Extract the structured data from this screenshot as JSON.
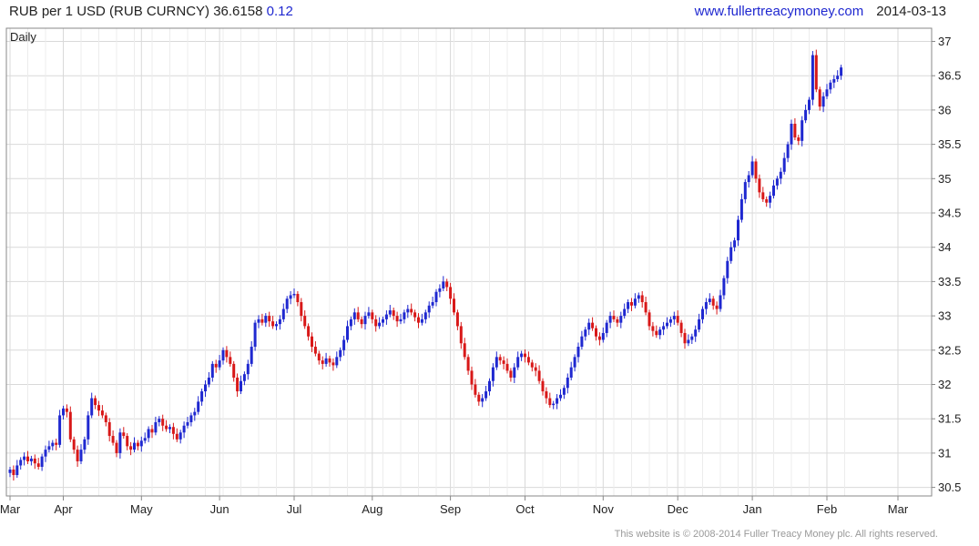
{
  "header": {
    "title": "RUB per 1 USD (RUB CURNCY)",
    "last": "36.6158",
    "change": "0.12",
    "website": "www.fullertreacymoney.com",
    "date": "2014-03-13"
  },
  "footer": {
    "copyright": "This website is © 2008-2014 Fuller Treacy Money plc. All rights reserved."
  },
  "colors": {
    "up": "#1f28d0",
    "down": "#d81818",
    "grid": "#d9d9d9",
    "frame": "#888888",
    "period_label": "#1f28d0"
  },
  "chart_data": {
    "type": "candlestick",
    "title": "RUB per 1 USD (RUB CURNCY)",
    "period_label": "Daily",
    "y_axis": {
      "position": "right",
      "ylim": [
        30.4,
        37.2
      ],
      "ticks": [
        30.5,
        31,
        31.5,
        32,
        32.5,
        33,
        33.5,
        34,
        34.5,
        35,
        35.5,
        36,
        36.5,
        37
      ]
    },
    "x_axis": {
      "months": [
        "Mar",
        "Apr",
        "May",
        "Jun",
        "Jul",
        "Aug",
        "Sep",
        "Oct",
        "Nov",
        "Dec",
        "Jan",
        "Feb",
        "Mar"
      ],
      "month_start_index": [
        0,
        15,
        37,
        59,
        80,
        102,
        124,
        145,
        167,
        188,
        209,
        230,
        250
      ]
    },
    "grid": true,
    "legend": "none",
    "closes": [
      30.76,
      30.68,
      30.82,
      30.9,
      30.95,
      30.88,
      30.92,
      30.85,
      30.8,
      30.95,
      31.05,
      31.1,
      31.15,
      31.12,
      31.55,
      31.65,
      31.6,
      31.2,
      31.05,
      30.88,
      31.05,
      31.2,
      31.55,
      31.8,
      31.7,
      31.62,
      31.55,
      31.45,
      31.25,
      31.15,
      31.0,
      31.3,
      31.25,
      31.1,
      31.05,
      31.15,
      31.1,
      31.18,
      31.22,
      31.35,
      31.3,
      31.45,
      31.5,
      31.4,
      31.35,
      31.38,
      31.28,
      31.2,
      31.3,
      31.4,
      31.45,
      31.55,
      31.6,
      31.75,
      31.9,
      32.0,
      32.1,
      32.3,
      32.25,
      32.35,
      32.5,
      32.4,
      32.3,
      32.1,
      31.9,
      32.05,
      32.15,
      32.3,
      32.55,
      32.9,
      32.95,
      32.9,
      33.0,
      32.92,
      32.85,
      32.88,
      32.95,
      33.1,
      33.25,
      33.3,
      33.32,
      33.2,
      33.0,
      32.85,
      32.7,
      32.55,
      32.45,
      32.35,
      32.3,
      32.38,
      32.32,
      32.28,
      32.4,
      32.5,
      32.65,
      32.85,
      32.95,
      33.05,
      32.95,
      32.88,
      33.0,
      33.05,
      32.95,
      32.85,
      32.9,
      32.95,
      33.02,
      33.08,
      33.0,
      32.92,
      32.95,
      33.05,
      33.1,
      33.05,
      32.98,
      32.9,
      32.95,
      33.05,
      33.15,
      33.2,
      33.35,
      33.4,
      33.5,
      33.42,
      33.25,
      33.05,
      32.85,
      32.6,
      32.4,
      32.2,
      32.0,
      31.85,
      31.75,
      31.8,
      31.9,
      32.05,
      32.25,
      32.4,
      32.35,
      32.3,
      32.2,
      32.1,
      32.25,
      32.4,
      32.45,
      32.4,
      32.32,
      32.25,
      32.2,
      32.05,
      31.9,
      31.8,
      31.7,
      31.72,
      31.8,
      31.85,
      31.95,
      32.1,
      32.25,
      32.4,
      32.55,
      32.7,
      32.8,
      32.9,
      32.82,
      32.7,
      32.65,
      32.75,
      32.9,
      33.0,
      32.95,
      32.9,
      33.0,
      33.1,
      33.2,
      33.15,
      33.25,
      33.3,
      33.2,
      33.05,
      32.85,
      32.78,
      32.72,
      32.8,
      32.85,
      32.9,
      32.95,
      33.0,
      32.9,
      32.75,
      32.6,
      32.65,
      32.7,
      32.8,
      32.95,
      33.1,
      33.2,
      33.25,
      33.15,
      33.1,
      33.3,
      33.55,
      33.8,
      34.0,
      34.1,
      34.4,
      34.7,
      34.95,
      35.05,
      35.25,
      35.0,
      34.8,
      34.7,
      34.65,
      34.75,
      34.9,
      35.0,
      35.1,
      35.3,
      35.5,
      35.8,
      35.6,
      35.55,
      35.85,
      36.0,
      36.15,
      36.8,
      36.3,
      36.05,
      36.2,
      36.3,
      36.4,
      36.45,
      36.5,
      36.62
    ]
  }
}
